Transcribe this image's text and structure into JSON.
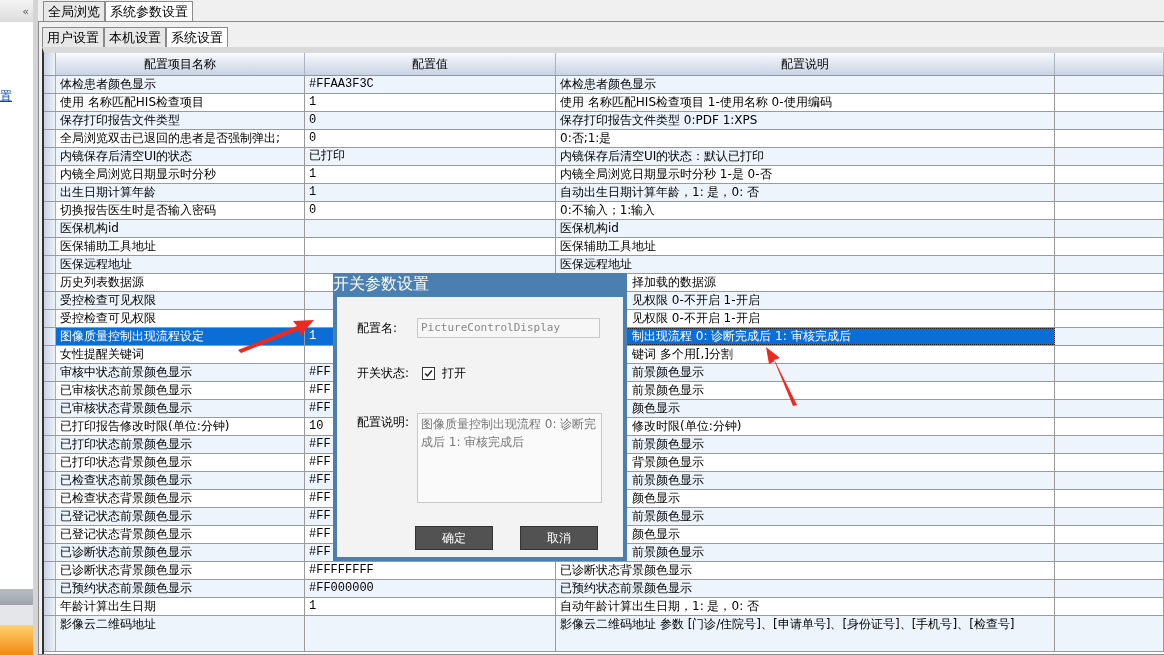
{
  "sidebar": {
    "collapse": "«",
    "link": "置"
  },
  "tabs": [
    {
      "label": "全局浏览",
      "selected": false
    },
    {
      "label": "系统参数设置",
      "selected": true
    }
  ],
  "subtabs": [
    {
      "label": "用户设置",
      "selected": false
    },
    {
      "label": "本机设置",
      "selected": false
    },
    {
      "label": "系统设置",
      "selected": true
    }
  ],
  "table": {
    "columns": [
      "配置项目名称",
      "配置值",
      "配置说明"
    ],
    "rows": [
      {
        "name": "体检患者颜色显示",
        "value": "#FFAA3F3C",
        "description": "体检患者颜色显示",
        "selected": false
      },
      {
        "name": "使用 名称匹配HIS检查项目",
        "value": "1",
        "description": "使用 名称匹配HIS检查项目 1-使用名称 0-使用编码",
        "selected": false
      },
      {
        "name": "保存打印报告文件类型",
        "value": "0",
        "description": "保存打印报告文件类型 0:PDF 1:XPS",
        "selected": false
      },
      {
        "name": "全局浏览双击已退回的患者是否强制弹出;",
        "value": "0",
        "description": "0:否;1:是",
        "selected": false
      },
      {
        "name": "内镜保存后清空UI的状态",
        "value": "已打印",
        "description": "内镜保存后清空UI的状态：默认已打印",
        "selected": false
      },
      {
        "name": "内镜全局浏览日期显示时分秒",
        "value": "1",
        "description": "内镜全局浏览日期显示时分秒 1-是 0-否",
        "selected": false
      },
      {
        "name": "出生日期计算年龄",
        "value": "1",
        "description": "自动出生日期计算年龄，1: 是，0: 否",
        "selected": false
      },
      {
        "name": "切换报告医生时是否输入密码",
        "value": "0",
        "description": "0:不输入；1:输入",
        "selected": false
      },
      {
        "name": "医保机构id",
        "value": "",
        "description": "医保机构id",
        "selected": false
      },
      {
        "name": "医保辅助工具地址",
        "value": "",
        "description": "医保辅助工具地址",
        "selected": false
      },
      {
        "name": "医保远程地址",
        "value": "",
        "description": "医保远程地址",
        "selected": false
      },
      {
        "name": "历史列表数据源",
        "value": "",
        "description": "择加载的数据源",
        "selected": false,
        "clipped": true
      },
      {
        "name": "受控检查可见权限",
        "value": "",
        "description": "见权限 0-不开启 1-开启",
        "selected": false,
        "clipped": true
      },
      {
        "name": "受控检查可见权限",
        "value": "",
        "description": "见权限 0-不开启 1-开启",
        "selected": false,
        "clipped": true
      },
      {
        "name": "图像质量控制出现流程设定",
        "value": "1",
        "description": "制出现流程 0: 诊断完成后 1: 审核完成后",
        "selected": true,
        "clipped": true
      },
      {
        "name": "女性提醒关键词",
        "value": "",
        "description": "键词 多个用[,]分割",
        "selected": false,
        "clipped": true
      },
      {
        "name": "审核中状态前景颜色显示",
        "value": "#FF",
        "description": "前景颜色显示",
        "selected": false,
        "clipped": true
      },
      {
        "name": "已审核状态前景颜色显示",
        "value": "#FF",
        "description": "前景颜色显示",
        "selected": false,
        "clipped": true
      },
      {
        "name": "已审核状态背景颜色显示",
        "value": "#FF",
        "description": "颜色显示",
        "selected": false,
        "clipped": true
      },
      {
        "name": "已打印报告修改时限(单位:分钟)",
        "value": "10",
        "description": "修改时限(单位:分钟)",
        "selected": false,
        "clipped": true
      },
      {
        "name": "已打印状态前景颜色显示",
        "value": "#FF",
        "description": "前景颜色显示",
        "selected": false,
        "clipped": true
      },
      {
        "name": "已打印状态背景颜色显示",
        "value": "#FF",
        "description": "背景颜色显示",
        "selected": false,
        "clipped": true
      },
      {
        "name": "已检查状态前景颜色显示",
        "value": "#FF",
        "description": "前景颜色显示",
        "selected": false,
        "clipped": true
      },
      {
        "name": "已检查状态背景颜色显示",
        "value": "#FF",
        "description": "颜色显示",
        "selected": false,
        "clipped": true
      },
      {
        "name": "已登记状态前景颜色显示",
        "value": "#FF",
        "description": "前景颜色显示",
        "selected": false,
        "clipped": true
      },
      {
        "name": "已登记状态背景颜色显示",
        "value": "#FF",
        "description": "颜色显示",
        "selected": false,
        "clipped": true
      },
      {
        "name": "已诊断状态前景颜色显示",
        "value": "#FF",
        "description": "前景颜色显示",
        "selected": false,
        "clipped": true
      },
      {
        "name": "已诊断状态背景颜色显示",
        "value": "#FFFFFFFF",
        "description": "已诊断状态背景颜色显示",
        "selected": false
      },
      {
        "name": "已预约状态前景颜色显示",
        "value": "#FF000000",
        "description": "已预约状态前景颜色显示",
        "selected": false
      },
      {
        "name": "年龄计算出生日期",
        "value": "1",
        "description": "自动年龄计算出生日期，1: 是，0: 否",
        "selected": false
      },
      {
        "name": "影像云二维码地址",
        "value": "",
        "description": "影像云二维码地址 参数 [门诊/住院号]、[申请单号]、[身份证号]、[手机号]、[检查号]",
        "selected": false
      }
    ]
  },
  "dialog": {
    "title": "开关参数设置",
    "name_label": "配置名:",
    "name_value": "PictureControlDisplay",
    "switch_label": "开关状态:",
    "switch": {
      "checked": true,
      "label": "打开"
    },
    "desc_label": "配置说明:",
    "desc_value": "图像质量控制出现流程 0: 诊断完成后 1: 审核完成后",
    "buttons": [
      "确定",
      "取消"
    ]
  }
}
